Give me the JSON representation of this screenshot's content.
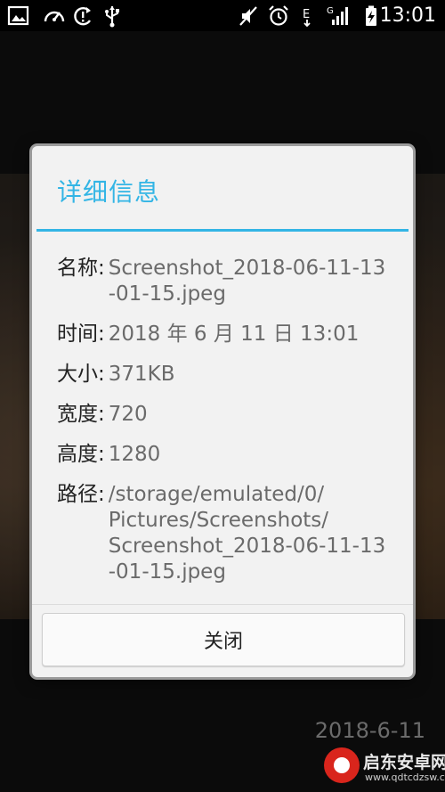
{
  "status_bar": {
    "time": "13:01",
    "icons": [
      "image-notification-icon",
      "speedometer-icon",
      "sync-alert-icon",
      "usb-icon",
      "mute-icon",
      "alarm-icon",
      "edge-network-icon",
      "signal-icon",
      "battery-charging-icon"
    ],
    "network_letter": "G",
    "edge_letter": "E"
  },
  "background": {
    "photo_date": "2018-6-11"
  },
  "dialog": {
    "title": "详细信息",
    "rows": [
      {
        "label": "名称:",
        "value": "Screenshot_2018-06-11-13\n-01-15.jpeg"
      },
      {
        "label": "时间:",
        "value": "2018 年 6 月 11 日 13:01"
      },
      {
        "label": "大小:",
        "value": "371KB"
      },
      {
        "label": "宽度:",
        "value": "720"
      },
      {
        "label": "高度:",
        "value": "1280"
      },
      {
        "label": "路径:",
        "value": "/storage/emulated/0/\nPictures/Screenshots/\nScreenshot_2018-06-11-13\n-01-15.jpeg"
      }
    ],
    "close_label": "关闭"
  },
  "watermark": {
    "title": "启东安卓网",
    "subtitle": "www.qdtcdzsw.com"
  },
  "colors": {
    "accent": "#33b5e5",
    "dialog_bg": "#f2f2f2",
    "value_text": "#6a6a6a"
  }
}
